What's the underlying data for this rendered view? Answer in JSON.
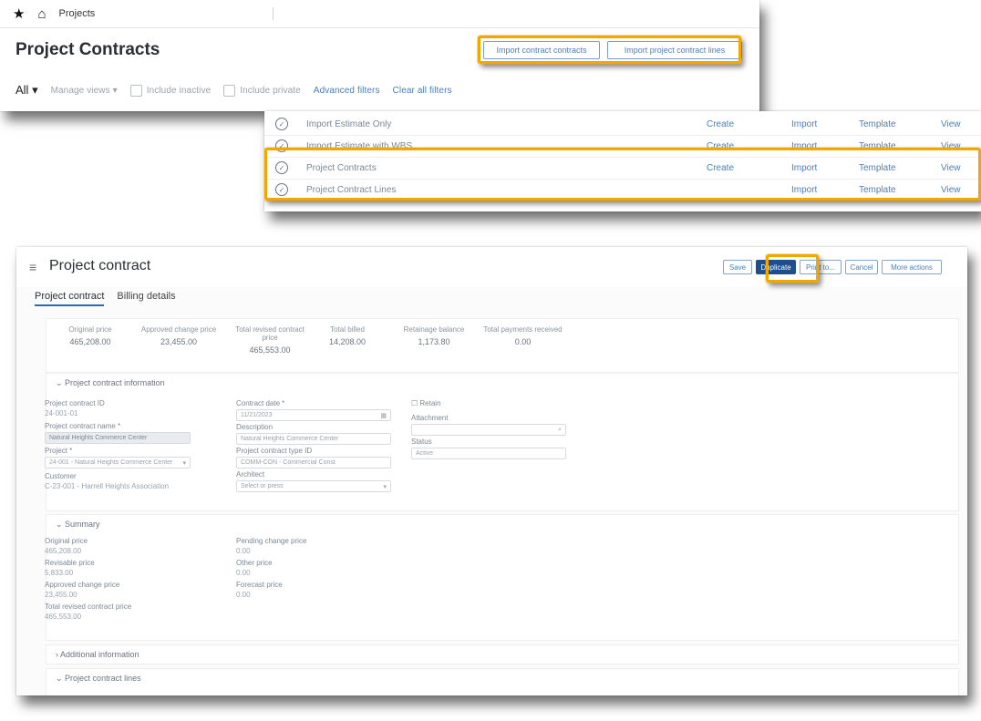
{
  "panel1": {
    "nav": {
      "star_icon": "star-icon",
      "home_icon": "home-icon",
      "tab": "Projects"
    },
    "title": "Project Contracts",
    "buttons": {
      "import_contracts": "Import contract contracts",
      "import_lines": "Import project contract lines"
    },
    "filters": {
      "all": "All",
      "manage_views": "Manage views",
      "include_inactive": "Include inactive",
      "include_private": "Include private",
      "advanced_filters": "Advanced filters",
      "clear_filters": "Clear all filters"
    }
  },
  "panel2": {
    "rows": [
      {
        "name": "Import Estimate Only",
        "create": "Create",
        "import": "Import",
        "template": "Template",
        "view": "View"
      },
      {
        "name": "Import Estimate with WBS",
        "create": "Create",
        "import": "Import",
        "template": "Template",
        "view": "View"
      },
      {
        "name": "Project Contracts",
        "create": "Create",
        "import": "Import",
        "template": "Template",
        "view": "View"
      },
      {
        "name": "Project Contract Lines",
        "create": "",
        "import": "Import",
        "template": "Template",
        "view": "View"
      }
    ]
  },
  "panel3": {
    "title": "Project contract",
    "toolbar": {
      "save": "Save",
      "duplicate": "Duplicate",
      "print": "Print to...",
      "cancel": "Cancel",
      "more": "More actions"
    },
    "tabs": {
      "contract": "Project contract",
      "billing": "Billing details"
    },
    "summary": [
      {
        "label": "Original price",
        "value": "465,208.00"
      },
      {
        "label": "Approved change price",
        "value": "23,455.00"
      },
      {
        "label": "Total revised contract price",
        "value": "465,553.00"
      },
      {
        "label": "Total billed",
        "value": "14,208.00"
      },
      {
        "label": "Retainage balance",
        "value": "1,173.80"
      },
      {
        "label": "Total payments received",
        "value": "0.00"
      }
    ],
    "info": {
      "header": "Project contract information",
      "contract_id_label": "Project contract ID",
      "contract_id": "24-001-01",
      "contract_name_label": "Project contract name *",
      "contract_name": "Natural Heights Commerce Center",
      "project_label": "Project *",
      "project": "24-001 - Natural Heights Commerce Center",
      "customer_label": "Customer",
      "customer": "C-23-001 - Harrell Heights Association",
      "contract_date_label": "Contract date *",
      "contract_date": "11/21/2023",
      "description_label": "Description",
      "description": "Natural Heights Commerce Center",
      "type_label": "Project contract type ID",
      "type": "COMM-CON - Commercial Const",
      "architect_label": "Architect",
      "architect": "Select or press",
      "retain_label": "Retain",
      "attachment_label": "Attachment",
      "status_label": "Status",
      "status": "Active"
    },
    "summary_card": {
      "header": "Summary",
      "original_label": "Original price",
      "original": "465,208.00",
      "revisable_label": "Revisable price",
      "revisable": "5,833.00",
      "approved_label": "Approved change price",
      "approved": "23,455.00",
      "total_label": "Total revised contract price",
      "total": "465,553.00",
      "pending_label": "Pending change price",
      "pending": "0.00",
      "other_label": "Other price",
      "other": "0.00",
      "forecast_label": "Forecast price",
      "forecast": "0.00"
    },
    "additional": "Additional information",
    "lines": "Project contract lines"
  },
  "colors": {
    "highlight": "#f0a700",
    "link": "#4a7fbf",
    "primary": "#1f4e8c"
  }
}
